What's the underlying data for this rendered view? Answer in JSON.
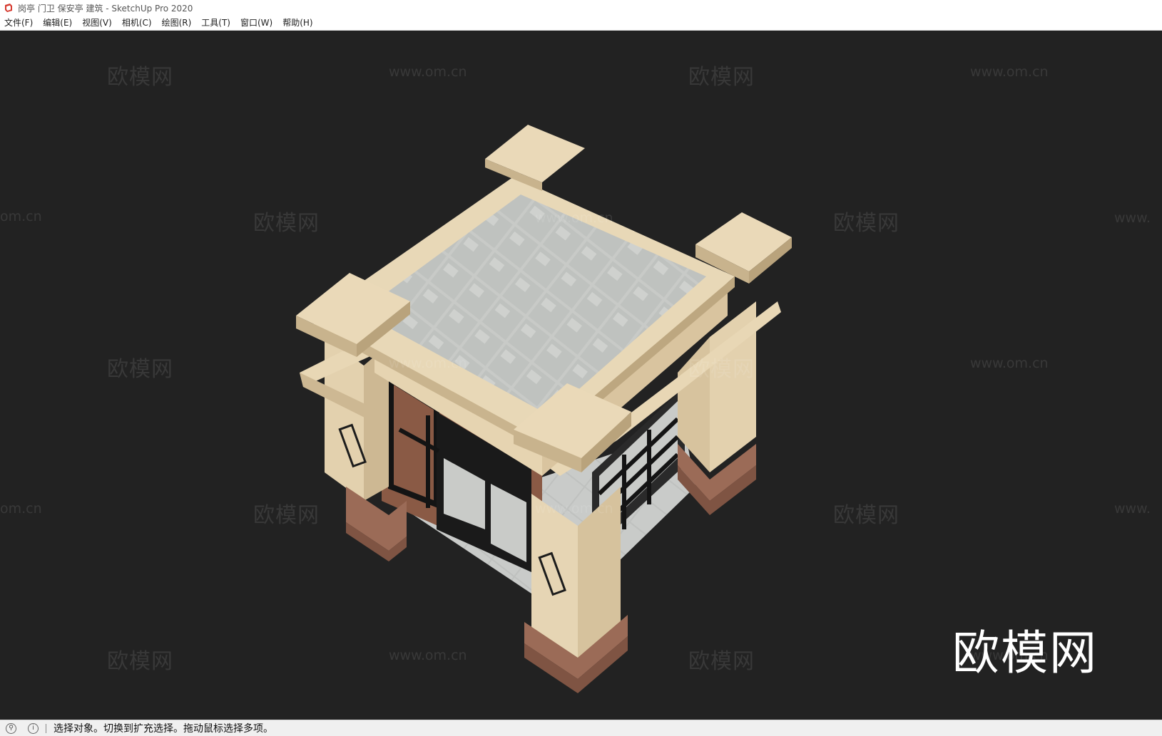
{
  "window": {
    "title": "岗亭 门卫 保安亭 建筑 - SketchUp Pro 2020"
  },
  "menu": {
    "items": [
      "文件(F)",
      "编辑(E)",
      "视图(V)",
      "相机(C)",
      "绘图(R)",
      "工具(T)",
      "窗口(W)",
      "帮助(H)"
    ]
  },
  "watermark": {
    "text_cn": "欧模网",
    "text_url": "www.om.cn",
    "text_url_partial_left": "om.cn",
    "text_url_partial_right": "www.",
    "big_logo": "欧模网"
  },
  "statusbar": {
    "message": "选择对象。切换到扩充选择。拖动鼠标选择多项。"
  },
  "icons": {
    "app": "sketchup-icon",
    "geo": "geo-location-icon",
    "info": "info-icon"
  },
  "colors": {
    "viewport_bg": "#222222",
    "stone": "#e6d5b4",
    "roof_tile": "#c9cbc8",
    "brick": "#8a5a45",
    "frame": "#1a1a1a"
  }
}
